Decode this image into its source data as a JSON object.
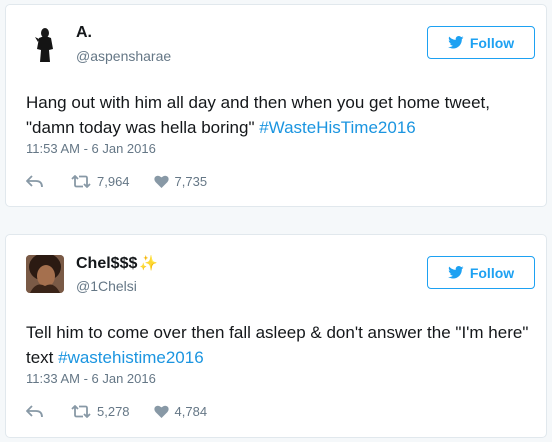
{
  "tweets": [
    {
      "display_name": "A.",
      "handle": "@aspensharae",
      "follow_label": "Follow",
      "text_main": "Hang out with him all day and then when you get home tweet, \"damn today was hella boring\" ",
      "hashtag": "#WasteHisTime2016",
      "text_tail": "",
      "timestamp": "11:53 AM - 6 Jan 2016",
      "retweets": "7,964",
      "likes": "7,735"
    },
    {
      "display_name": "Chel$$$",
      "name_emoji": "✨",
      "handle": "@1Chelsi",
      "follow_label": "Follow",
      "text_main": "Tell him to come over then fall asleep & don't answer the \"I'm here\" text ",
      "hashtag": "#wastehistime2016",
      "text_tail": "",
      "timestamp": "11:33 AM - 6 Jan 2016",
      "retweets": "5,278",
      "likes": "4,784"
    }
  ],
  "colors": {
    "accent": "#1da1f2",
    "hashtag": "#1b95e0",
    "muted": "#657786",
    "text": "#14171a",
    "border": "#e1e8ed",
    "background": "#f5f8fa"
  },
  "icons": [
    "twitter-bird-icon",
    "reply-icon",
    "retweet-icon",
    "heart-icon",
    "sparkles-icon"
  ]
}
